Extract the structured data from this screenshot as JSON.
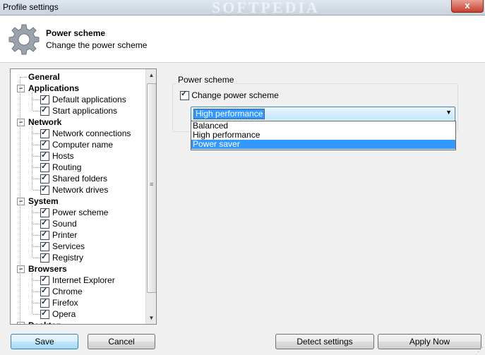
{
  "window": {
    "title": "Profile settings",
    "watermark": "SOFTPEDIA",
    "close_glyph": "x"
  },
  "header": {
    "title": "Power scheme",
    "subtitle": "Change the power scheme",
    "icon": "gear-icon"
  },
  "tree": {
    "check_glyph": "✓",
    "expander_glyph": "−",
    "items": [
      {
        "label": "General",
        "type": "category",
        "expandable": false
      },
      {
        "label": "Applications",
        "type": "category",
        "expandable": true
      },
      {
        "label": "Default applications",
        "type": "item",
        "checked": true
      },
      {
        "label": "Start applications",
        "type": "item",
        "checked": true
      },
      {
        "label": "Network",
        "type": "category",
        "expandable": true
      },
      {
        "label": "Network connections",
        "type": "item",
        "checked": true
      },
      {
        "label": "Computer name",
        "type": "item",
        "checked": true
      },
      {
        "label": "Hosts",
        "type": "item",
        "checked": true
      },
      {
        "label": "Routing",
        "type": "item",
        "checked": true
      },
      {
        "label": "Shared folders",
        "type": "item",
        "checked": true
      },
      {
        "label": "Network drives",
        "type": "item",
        "checked": true
      },
      {
        "label": "System",
        "type": "category",
        "expandable": true
      },
      {
        "label": "Power scheme",
        "type": "item",
        "checked": true
      },
      {
        "label": "Sound",
        "type": "item",
        "checked": true
      },
      {
        "label": "Printer",
        "type": "item",
        "checked": true
      },
      {
        "label": "Services",
        "type": "item",
        "checked": true
      },
      {
        "label": "Registry",
        "type": "item",
        "checked": true
      },
      {
        "label": "Browsers",
        "type": "category",
        "expandable": true
      },
      {
        "label": "Internet Explorer",
        "type": "item",
        "checked": true
      },
      {
        "label": "Chrome",
        "type": "item",
        "checked": true
      },
      {
        "label": "Firefox",
        "type": "item",
        "checked": true
      },
      {
        "label": "Opera",
        "type": "item",
        "checked": true
      },
      {
        "label": "Desktop",
        "type": "category",
        "expandable": true
      }
    ],
    "scroll_up_glyph": "▲",
    "scroll_down_glyph": "▼",
    "grip_glyph": "≡"
  },
  "power_scheme": {
    "group_label": "Power scheme",
    "change_checkbox_label": "Change power scheme",
    "change_checked": true,
    "selected": "High performance",
    "dropdown_arrow": "▼",
    "options": [
      "Balanced",
      "High performance",
      "Power saver"
    ],
    "highlighted_option": "Power saver"
  },
  "footer": {
    "save_label": "Save",
    "cancel_label": "Cancel",
    "detect_label": "Detect settings",
    "apply_label": "Apply Now"
  },
  "colors": {
    "selection": "#3399ff",
    "default_button_border": "#3c7fb1"
  }
}
